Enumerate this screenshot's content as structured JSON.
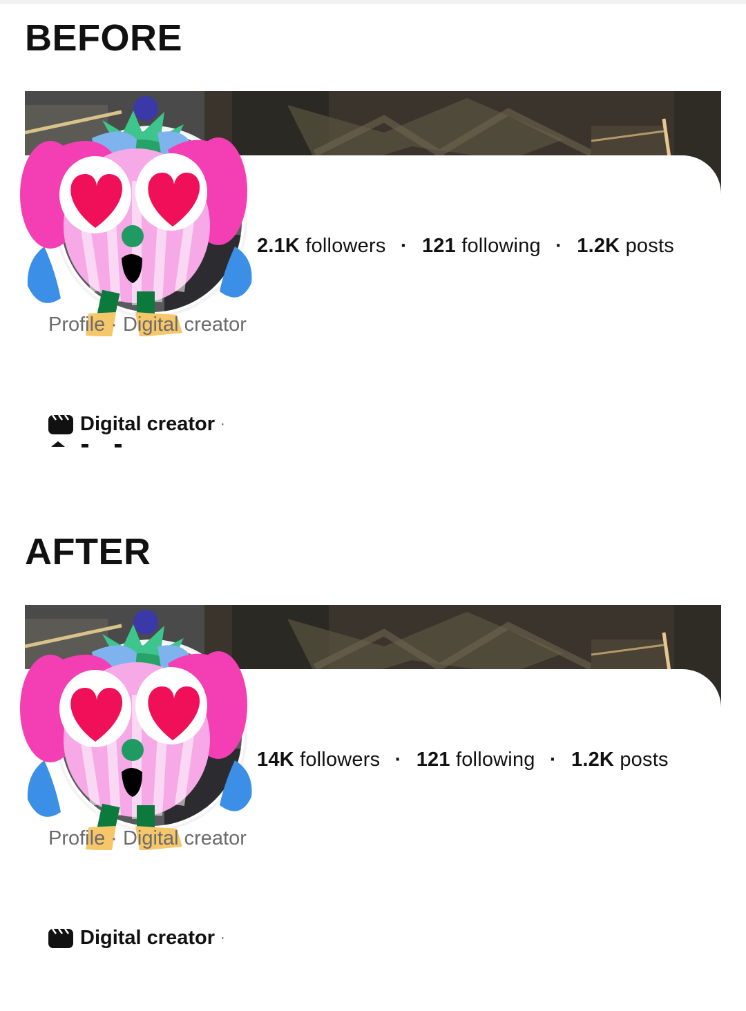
{
  "before": {
    "heading": "BEFORE",
    "stats": {
      "followers_count": "2.1K",
      "followers_label": "followers",
      "following_count": "121",
      "following_label": "following",
      "posts_count": "1.2K",
      "posts_label": "posts",
      "separator": "·"
    },
    "profile_line": "Profile · Digital creator",
    "category": {
      "label": "Digital creator",
      "icon": "clapperboard-icon",
      "separator": "·"
    }
  },
  "after": {
    "heading": "AFTER",
    "stats": {
      "followers_count": "14K",
      "followers_label": "followers",
      "following_count": "121",
      "following_label": "following",
      "posts_count": "1.2K",
      "posts_label": "posts",
      "separator": "·"
    },
    "profile_line": "Profile · Digital creator",
    "category": {
      "label": "Digital creator",
      "icon": "clapperboard-icon",
      "separator": "·"
    }
  },
  "colors": {
    "sticker_pink": "#f43fb4",
    "sticker_light_pink": "#f6a9e6",
    "heart_red": "#f0105a",
    "nose_green": "#1f9a63",
    "tear_blue": "#3b8fe6",
    "leaf_green": "#3ec58d",
    "leg_green": "#0c7a3d",
    "boot_yellow": "#f6c66a",
    "cover_dark": "#3a342c"
  }
}
